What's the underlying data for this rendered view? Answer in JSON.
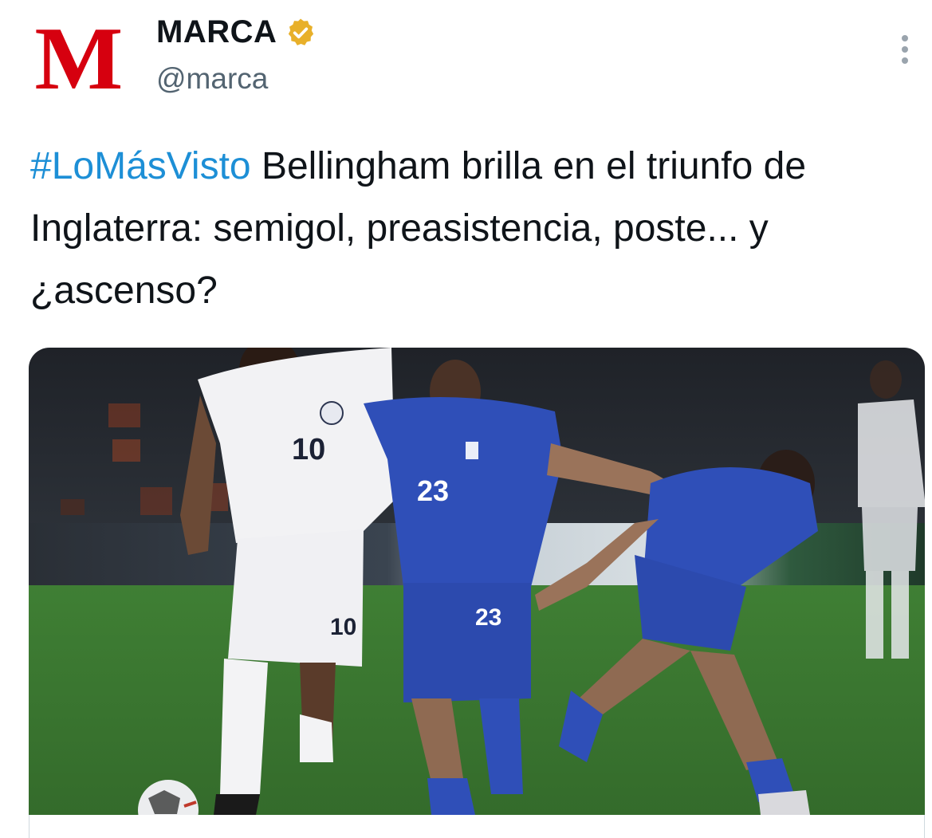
{
  "author": {
    "avatar_letter": "M",
    "display_name": "MARCA",
    "handle": "@marca",
    "verified": true,
    "verified_badge_color": "#e8b02a",
    "brand_color": "#d6000f"
  },
  "tweet": {
    "hashtag": "#LoMásVisto",
    "text": " Bellingham brilla en el triunfo de Inglaterra: semigol, preasistencia, poste... y ¿ascenso?"
  },
  "media": {
    "players": [
      {
        "team": "england",
        "kit_color": "#f2f2f4",
        "shirt_number": "10",
        "short_number": "10"
      },
      {
        "team": "greece",
        "kit_color": "#2f4fb8",
        "shirt_number": "23",
        "short_number": "23"
      },
      {
        "team": "greece",
        "kit_color": "#2f4fb8",
        "shirt_number": "",
        "short_number": ""
      }
    ]
  },
  "icons": {
    "more": "more-vertical-icon",
    "verified": "verified-badge-icon"
  },
  "colors": {
    "hashtag": "#1d8fd6",
    "secondary_text": "#536471",
    "pitch": "#3e7a32"
  }
}
